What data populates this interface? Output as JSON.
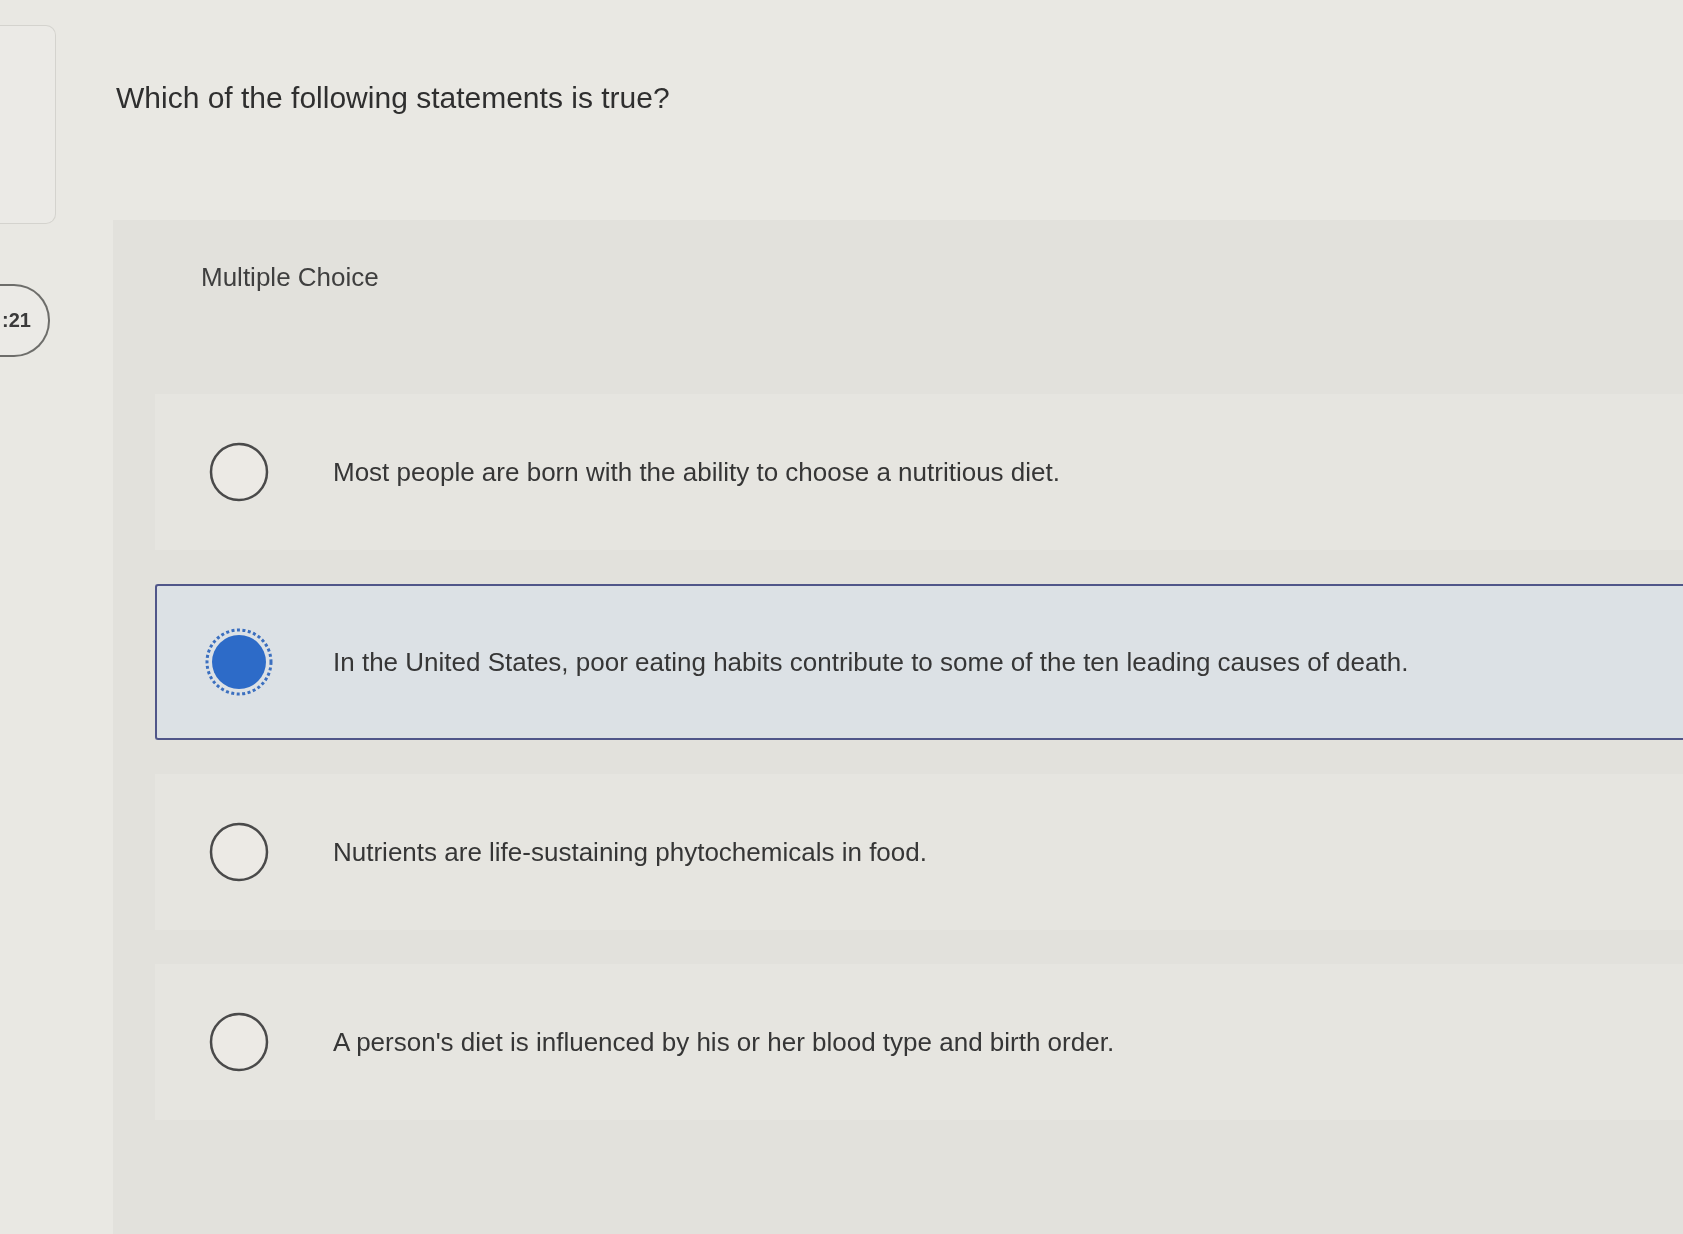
{
  "timer": {
    "text": ":21"
  },
  "question": "Which of the following statements is true?",
  "answer_panel": {
    "title": "Multiple Choice",
    "options": [
      {
        "text": "Most people are born with the ability to choose a nutritious diet.",
        "selected": false
      },
      {
        "text": "In the United States, poor eating habits contribute to some of the ten leading causes of death.",
        "selected": true
      },
      {
        "text": "Nutrients are life-sustaining phytochemicals in food.",
        "selected": false
      },
      {
        "text": "A person's diet is influenced by his or her blood type and birth order.",
        "selected": false
      }
    ]
  }
}
